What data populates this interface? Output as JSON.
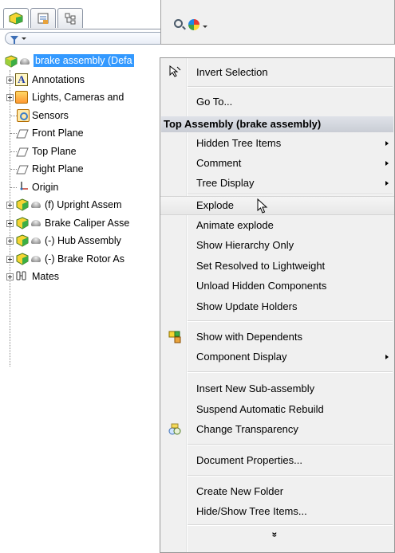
{
  "tree": {
    "tabs": [
      {
        "icon": "feature-manager-icon",
        "active": true
      },
      {
        "icon": "property-manager-icon",
        "active": false
      },
      {
        "icon": "configuration-manager-icon",
        "active": false
      }
    ],
    "filter_icon": "filter-icon",
    "items": [
      {
        "label": "brake assembly  (Defa",
        "icon": "assembly-icon"
      },
      {
        "label": "Annotations",
        "icon": "annotations-icon"
      },
      {
        "label": "Lights, Cameras and",
        "icon": "lights-icon"
      },
      {
        "label": "Sensors",
        "icon": "sensors-icon"
      },
      {
        "label": "Front Plane",
        "icon": "plane-icon"
      },
      {
        "label": "Top Plane",
        "icon": "plane-icon"
      },
      {
        "label": "Right Plane",
        "icon": "plane-icon"
      },
      {
        "label": "Origin",
        "icon": "origin-icon"
      },
      {
        "label": "(f) Upright Assem",
        "icon": "subassembly-icon"
      },
      {
        "label": "Brake Caliper Asse",
        "icon": "subassembly-icon"
      },
      {
        "label": "(-) Hub Assembly",
        "icon": "subassembly-icon"
      },
      {
        "label": "(-) Brake Rotor As",
        "icon": "subassembly-icon"
      },
      {
        "label": "Mates",
        "icon": "mates-icon"
      }
    ]
  },
  "toolbar": {
    "icons": [
      "zoom-icon",
      "appearance-icon"
    ]
  },
  "menu": {
    "invert_selection": "Invert Selection",
    "go_to": "Go To...",
    "section_title": "Top Assembly (brake assembly)",
    "hidden_tree_items": "Hidden Tree Items",
    "comment": "Comment",
    "tree_display": "Tree Display",
    "explode": "Explode",
    "animate_explode": "Animate explode",
    "show_hierarchy_only": "Show Hierarchy Only",
    "set_resolved": "Set Resolved to Lightweight",
    "unload_hidden": "Unload Hidden Components",
    "show_update_holders": "Show Update Holders",
    "show_with_dependents": "Show with Dependents",
    "component_display": "Component Display",
    "insert_new_subassembly": "Insert New Sub-assembly",
    "suspend_rebuild": "Suspend Automatic Rebuild",
    "change_transparency": "Change Transparency",
    "document_properties": "Document Properties...",
    "create_new_folder": "Create New Folder",
    "hide_show_tree_items": "Hide/Show Tree Items...",
    "expand_chevron": "»"
  }
}
